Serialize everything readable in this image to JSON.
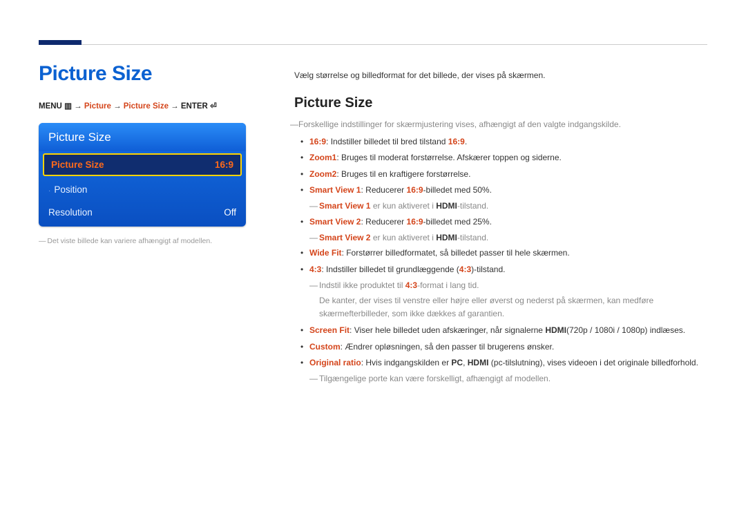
{
  "header": {
    "title": "Picture Size"
  },
  "navpath": {
    "menu": "MENU",
    "menu_icon": "▥",
    "arrow": " → ",
    "p1": "Picture",
    "p2": "Picture Size",
    "enter": "ENTER",
    "enter_icon": "⏎"
  },
  "osd": {
    "title": "Picture Size",
    "rows": [
      {
        "label": "Picture Size",
        "value": "16:9",
        "selected": true
      },
      {
        "label": "Position",
        "value": "",
        "marker": "·"
      },
      {
        "label": "Resolution",
        "value": "Off"
      }
    ]
  },
  "footnote": "Det viste billede kan variere afhængigt af modellen.",
  "right": {
    "intro": "Vælg størrelse og billedformat for det billede, der vises på skærmen.",
    "h2": "Picture Size",
    "prenote": "Forskellige indstillinger for skærmjustering vises, afhængigt af den valgte indgangskilde.",
    "items": {
      "i0": {
        "kw": "16:9",
        "t1": ": Indstiller billedet til bred tilstand ",
        "kw2": "16:9",
        "t2": "."
      },
      "i1": {
        "kw": "Zoom1",
        "t": ": Bruges til moderat forstørrelse. Afskærer toppen og siderne."
      },
      "i2": {
        "kw": "Zoom2",
        "t": ": Bruges til en kraftigere forstørrelse."
      },
      "i3": {
        "kw": "Smart View 1",
        "t1": ": Reducerer ",
        "kw2": "16:9",
        "t2": "-billedet med 50%."
      },
      "i3n": {
        "kw": "Smart View 1",
        "t1": " er kun aktiveret i ",
        "b": "HDMI",
        "t2": "-tilstand."
      },
      "i4": {
        "kw": "Smart View 2",
        "t1": ": Reducerer ",
        "kw2": "16:9",
        "t2": "-billedet med 25%."
      },
      "i4n": {
        "kw": "Smart View 2",
        "t1": " er kun aktiveret i ",
        "b": "HDMI",
        "t2": "-tilstand."
      },
      "i5": {
        "kw": "Wide Fit",
        "t": ": Forstørrer billedformatet, så billedet passer til hele skærmen."
      },
      "i6": {
        "kw": "4:3",
        "t1": ": Indstiller billedet til grundlæggende (",
        "kw2": "4:3",
        "t2": ")-tilstand."
      },
      "i6n1": {
        "t1": "Indstil ikke produktet til ",
        "kw": "4:3",
        "t2": "-format i lang tid."
      },
      "i6n2": "De kanter, der vises til venstre eller højre eller øverst og nederst på skærmen, kan medføre skærmefterbilleder, som ikke dækkes af garantien.",
      "i7": {
        "kw": "Screen Fit",
        "t1": ": Viser hele billedet uden afskæringer, når signalerne ",
        "b": "HDMI",
        "t2": "(720p / 1080i / 1080p) indlæses."
      },
      "i8": {
        "kw": "Custom",
        "t": ": Ændrer opløsningen, så den passer til brugerens ønsker."
      },
      "i9": {
        "kw": "Original ratio",
        "t1": ": Hvis indgangskilden er ",
        "b1": "PC",
        "t2": ", ",
        "b2": "HDMI",
        "t3": " (pc-tilslutning), vises videoen i det originale billedforhold."
      },
      "i9n": "Tilgængelige porte kan være forskelligt, afhængigt af modellen."
    }
  }
}
